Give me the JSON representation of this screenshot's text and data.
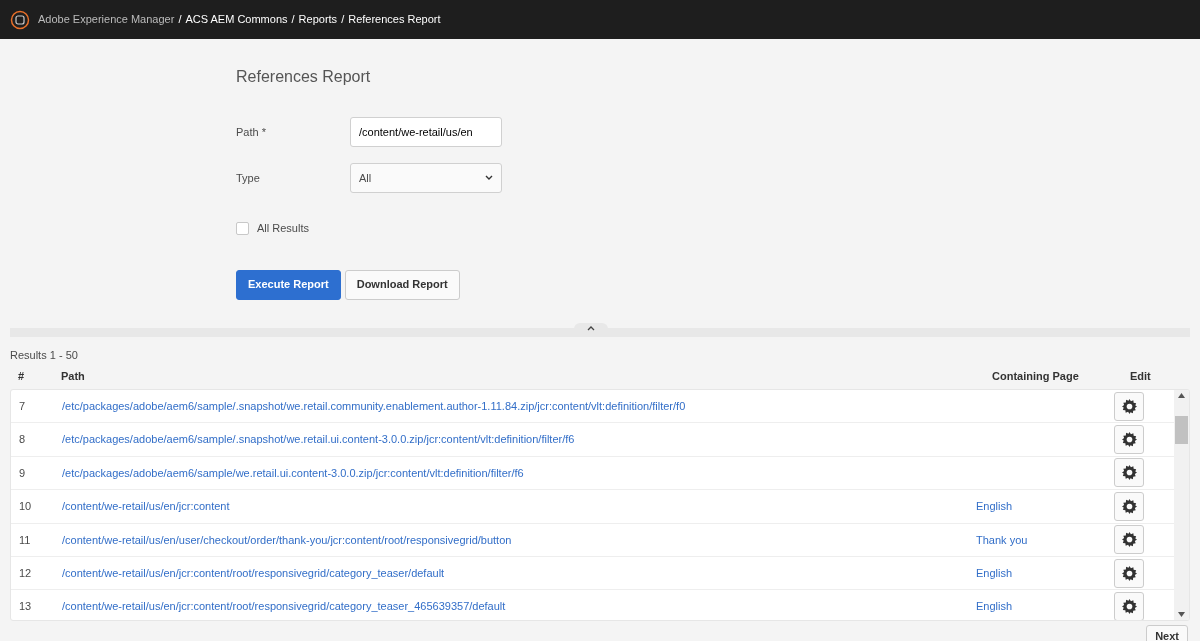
{
  "header": {
    "app": "Adobe Experience Manager",
    "separator": "/",
    "breadcrumbs": [
      "ACS AEM Commons",
      "Reports",
      "References Report"
    ]
  },
  "form": {
    "title": "References Report",
    "path_label": "Path *",
    "path_value": "/content/we-retail/us/en",
    "type_label": "Type",
    "type_value": "All",
    "all_results": {
      "label": "All Results",
      "checked": false
    },
    "buttons": [
      {
        "label": "Execute Report",
        "kind": "primary"
      },
      {
        "label": "Download Report",
        "kind": "secondary"
      }
    ]
  },
  "results": {
    "summary": "Results 1 - 50",
    "columns": [
      "#",
      "Path",
      "Containing Page",
      "Edit"
    ],
    "rows": [
      {
        "num": "7",
        "path": "/etc/packages/adobe/aem6/sample/.snapshot/we.retail.community.enablement.author-1.11.84.zip/jcr:content/vlt:definition/filter/f0"
      },
      {
        "num": "8",
        "path": "/etc/packages/adobe/aem6/sample/.snapshot/we.retail.ui.content-3.0.0.zip/jcr:content/vlt:definition/filter/f6"
      },
      {
        "num": "9",
        "path": "/etc/packages/adobe/aem6/sample/we.retail.ui.content-3.0.0.zip/jcr:content/vlt:definition/filter/f6"
      },
      {
        "num": "10",
        "path": "/content/we-retail/us/en/jcr:content",
        "page": "English"
      },
      {
        "num": "11",
        "path": "/content/we-retail/us/en/user/checkout/order/thank-you/jcr:content/root/responsivegrid/button",
        "page": "Thank you"
      },
      {
        "num": "12",
        "path": "/content/we-retail/us/en/jcr:content/root/responsivegrid/category_teaser/default",
        "page": "English"
      },
      {
        "num": "13",
        "path": "/content/we-retail/us/en/jcr:content/root/responsivegrid/category_teaser_465639357/default",
        "page": "English"
      }
    ],
    "next": "Next"
  }
}
